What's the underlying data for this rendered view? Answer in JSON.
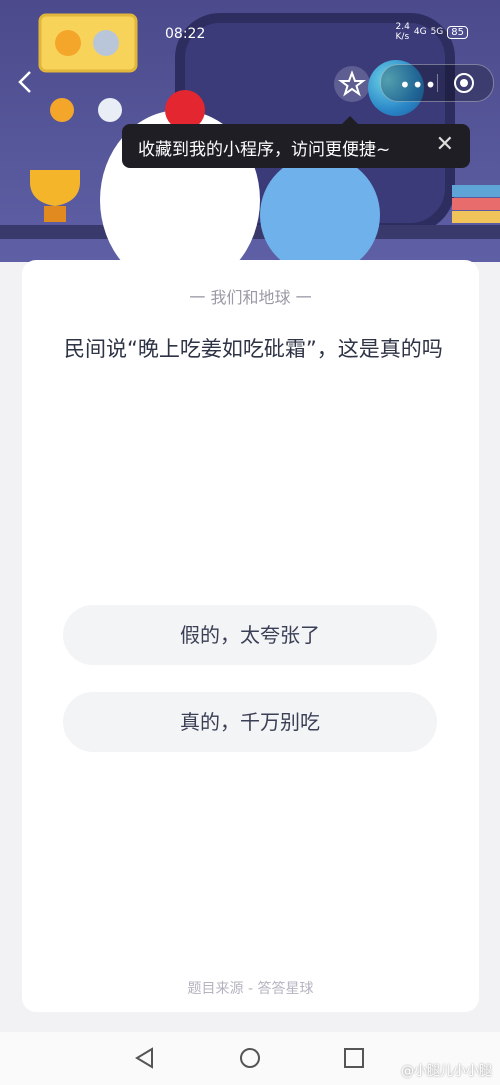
{
  "status_bar": {
    "time": "08:22",
    "net_speed": "2.4\nK/s",
    "signal_1": "4G",
    "signal_2": "5G",
    "battery": "85"
  },
  "tooltip": {
    "text": "收藏到我的小程序，访问更便捷~"
  },
  "quiz": {
    "category": "一 我们和地球 一",
    "question": "民间说“晚上吃姜如吃砒霜”，这是真的吗",
    "options": [
      {
        "label": "假的，太夸张了"
      },
      {
        "label": "真的，千万别吃"
      }
    ],
    "source": "题目来源 - 答答星球"
  },
  "watermark": "@小腿儿小小腿",
  "colors": {
    "hero_bg": "#4b4a8c",
    "card_bg": "#ffffff",
    "option_bg": "#f3f4f6",
    "question_text": "#2e3345"
  },
  "icons": [
    "back-icon",
    "star-icon",
    "more-icon",
    "target-icon",
    "close-icon",
    "nav-back-icon",
    "nav-home-icon",
    "nav-recent-icon"
  ]
}
